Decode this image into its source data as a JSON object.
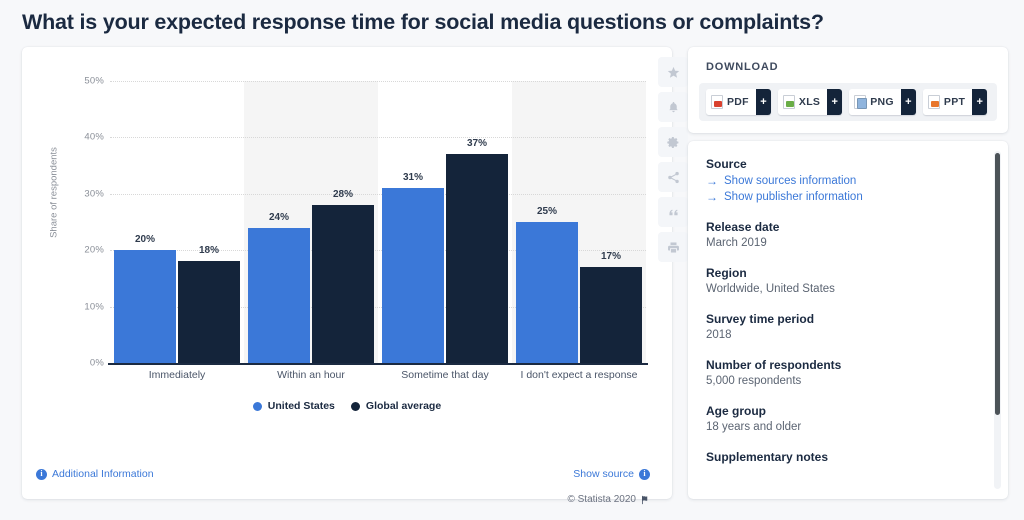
{
  "page": {
    "title": "What is your expected response time for social media questions or complaints?"
  },
  "chart_data": {
    "type": "bar",
    "title": "What is your expected response time for social media questions or complaints?",
    "xlabel": "",
    "ylabel": "Share of respondents",
    "ylim": [
      0,
      50
    ],
    "yticks": [
      "0%",
      "10%",
      "20%",
      "30%",
      "40%",
      "50%"
    ],
    "ytick_values": [
      0,
      10,
      20,
      30,
      40,
      50
    ],
    "grid": true,
    "legend_position": "bottom",
    "categories": [
      "Immediately",
      "Within an hour",
      "Sometime that day",
      "I don't expect a response"
    ],
    "series": [
      {
        "name": "United States",
        "color": "#3b78d8",
        "values": [
          20,
          24,
          31,
          25
        ],
        "labels": [
          "20%",
          "24%",
          "31%",
          "25%"
        ]
      },
      {
        "name": "Global average",
        "color": "#14243a",
        "values": [
          18,
          28,
          37,
          17
        ],
        "labels": [
          "18%",
          "28%",
          "37%",
          "17%"
        ]
      }
    ]
  },
  "chart_toolbar": {
    "buttons": [
      {
        "icon": "star-icon",
        "name": "favorite-button"
      },
      {
        "icon": "bell-icon",
        "name": "notify-button"
      },
      {
        "icon": "gear-icon",
        "name": "settings-button"
      },
      {
        "icon": "share-icon",
        "name": "share-button"
      },
      {
        "icon": "quote-icon",
        "name": "cite-button"
      },
      {
        "icon": "print-icon",
        "name": "print-button"
      }
    ]
  },
  "chart_footer": {
    "additional_information": "Additional Information",
    "copyright": "© Statista 2020",
    "show_source": "Show source",
    "info_glyph": "i"
  },
  "download": {
    "heading": "DOWNLOAD",
    "buttons": [
      {
        "label": "PDF",
        "plus": "+",
        "icon": "pdf-file-icon"
      },
      {
        "label": "XLS",
        "plus": "+",
        "icon": "xls-file-icon"
      },
      {
        "label": "PNG",
        "plus": "+",
        "icon": "png-file-icon"
      },
      {
        "label": "PPT",
        "plus": "+",
        "icon": "ppt-file-icon"
      }
    ]
  },
  "source_panel": {
    "source_heading": "Source",
    "link_sources": "Show sources information",
    "link_publisher": "Show publisher information",
    "arrow": "→",
    "release_date_heading": "Release date",
    "release_date_value": "March 2019",
    "region_heading": "Region",
    "region_value": "Worldwide, United States",
    "survey_period_heading": "Survey time period",
    "survey_period_value": "2018",
    "respondents_heading": "Number of respondents",
    "respondents_value": "5,000 respondents",
    "age_group_heading": "Age group",
    "age_group_value": "18 years and older",
    "supplementary_heading": "Supplementary notes"
  },
  "colors": {
    "series_us": "#3b78d8",
    "series_global": "#14243a",
    "link": "#3b78d8",
    "page_bg": "#f7f8fa",
    "text": "#1b2a41"
  }
}
